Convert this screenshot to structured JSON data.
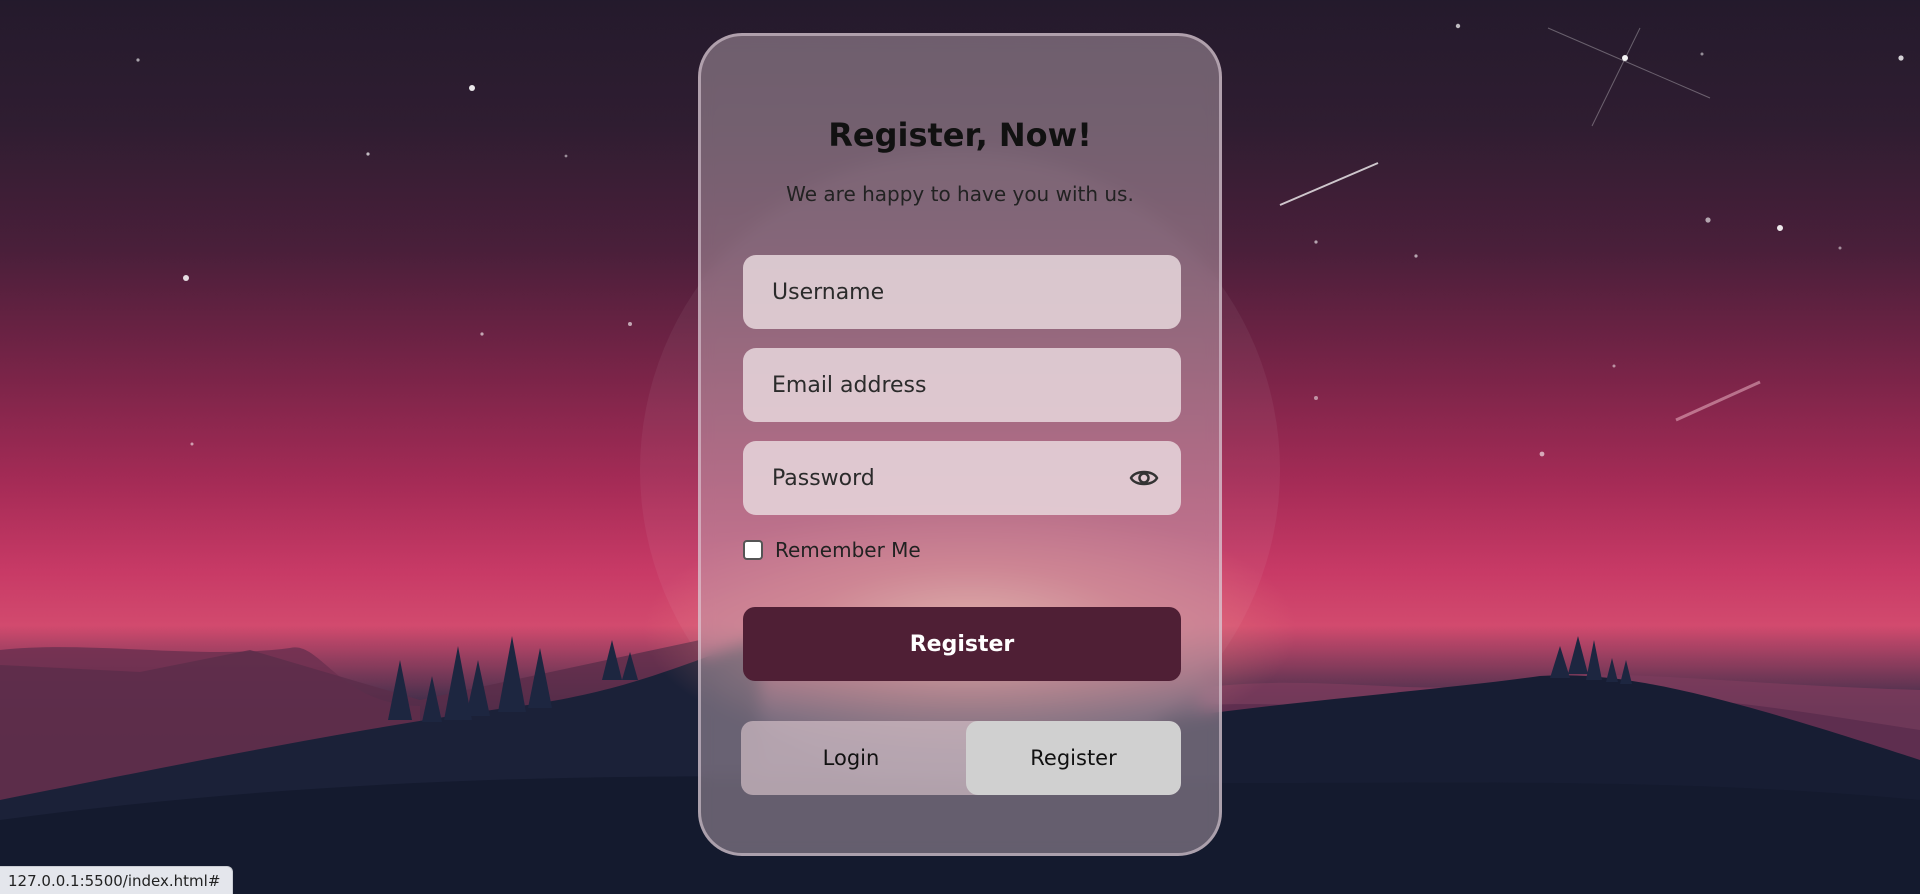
{
  "form": {
    "title": "Register, Now!",
    "subtitle": "We are happy to have you with us.",
    "username_placeholder": "Username",
    "email_placeholder": "Email address",
    "password_placeholder": "Password",
    "remember_label": "Remember Me",
    "submit_label": "Register"
  },
  "toggle": {
    "login_label": "Login",
    "register_label": "Register",
    "active": "Register"
  },
  "status_bar": {
    "url": "127.0.0.1:5500/index.html#"
  },
  "icons": {
    "password_toggle": "eye-icon"
  },
  "colors": {
    "accent": "#4f1f35",
    "toggle_active": "#d0d0d0"
  }
}
